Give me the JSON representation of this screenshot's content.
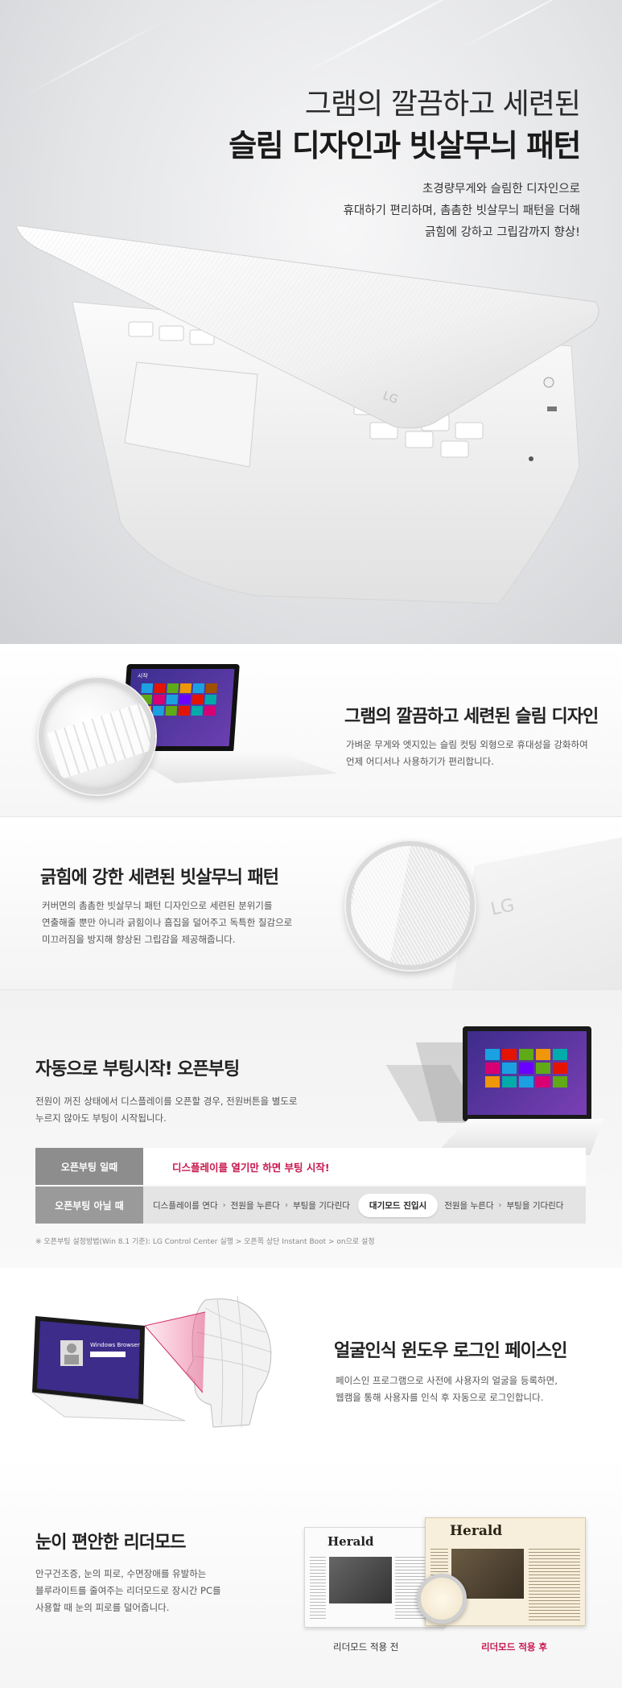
{
  "hero": {
    "title_line1": "그램의 깔끔하고 세련된",
    "title_line2": "슬림 디자인과 빗살무늬 패턴",
    "desc_lines": [
      "초경량무게와 슬림한 디자인으로",
      "휴대하기 편리하며, 촘촘한 빗살무늬 패턴을 더해",
      "긁힘에 강하고 그립감까지 향상!"
    ]
  },
  "sections": {
    "slim": {
      "title_plain": "그램의 깔끔하고 세련된 ",
      "title_bold": "슬림 디자인",
      "desc_lines": [
        "가벼운 무게와 엣지있는 슬림 컷팅 외형으로 휴대성을 강화하여",
        "언제 어디서나 사용하기가 편리합니다."
      ],
      "screen_label": "시작"
    },
    "pattern": {
      "title_plain": "긁힘에 강한 세련된 ",
      "title_bold": "빗살무늬 패턴",
      "desc_lines": [
        "커버면의 촘촘한 빗살무늬 패턴 디자인으로 세련된 분위기를",
        "연출해줄 뿐만 아니라 긁힘이나 흠집을 덜어주고 독특한 질감으로",
        "미끄러짐을 방지해 향상된 그립감을 제공해줍니다."
      ],
      "logo_text": "LG"
    },
    "boot": {
      "title_plain": "자동으로 부팅시작! ",
      "title_bold": "오픈부팅",
      "desc_lines": [
        "전원이 꺼진 상태에서 디스플레이를 오픈할 경우, 전원버튼을 별도로",
        "누르지 않아도 부팅이 시작됩니다."
      ],
      "row1_head": "오픈부팅 일때",
      "row1_text": "디스플레이를 열기만 하면 부팅 시작!",
      "row2_head": "오픈부팅 아닐 때",
      "row2_steps": [
        "디스플레이를 연다",
        "전원을 누른다",
        "부팅을 기다린다"
      ],
      "row2_pill": "대기모드 진입시",
      "row2_steps_after": [
        "전원을 누른다",
        "부팅을 기다린다"
      ],
      "note": "※ 오픈부팅 설정방법(Win 8.1 기준): LG Control Center 실행 > 오픈쪽 상단 Instant Boot > on으로 설정"
    },
    "face": {
      "title_plain": "얼굴인식 윈도우 로그인 ",
      "title_bold": "페이스인",
      "desc_lines": [
        "페이스인 프로그램으로 사전에 사용자의 얼굴을 등록하면,",
        "웹캠을 통해 사용자를 인식 후 자동으로 로그인합니다."
      ],
      "screen_label": "Windows Browser"
    },
    "reader": {
      "title_plain": "눈이 편안한 ",
      "title_bold": "리더모드",
      "desc_lines": [
        "안구건조증, 눈의 피로, 수면장애를 유발하는",
        "블루라이트를 줄여주는 리더모드로 장시간 PC를",
        "사용할 때 눈의 피로를 덜어줍니다."
      ],
      "paper_name": "Herald",
      "caption_before": "리더모드 적용 전",
      "caption_after": "리더모드 적용 후"
    }
  },
  "colors": {
    "accent": "#c8174e",
    "hero_bg": "#e4e5e7",
    "table_head": "#8d8d8d",
    "table_alt": "#e4e4e4",
    "window_purple": "#3d2c8a"
  }
}
